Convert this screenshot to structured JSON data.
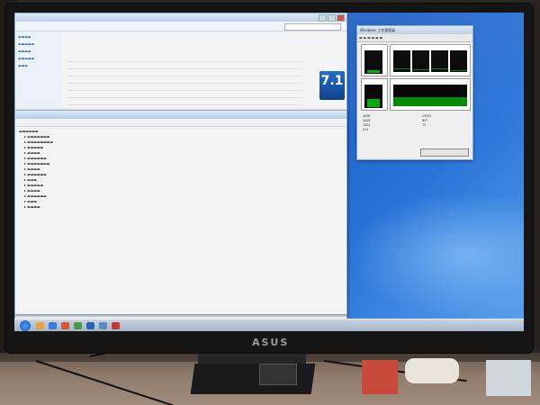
{
  "monitor": {
    "brand_logo": "ASUS"
  },
  "screen_text": {
    "rating_badge": "7.1",
    "task_manager_title": "Windows 工作管理員",
    "mem_stats": {
      "phys_total": "4096",
      "cache": "2048",
      "available": "1024",
      "free": "512",
      "handles": "23342",
      "threads": "857",
      "processes": "72"
    }
  },
  "colors": {
    "desktop_blue": "#2a74d8",
    "window_bg": "#f3f3f3",
    "bezel": "#151515",
    "cpu_graph": "#00aa00"
  },
  "icons": [
    "start-orb-icon",
    "folder-icon",
    "browser-icon",
    "media-icon",
    "windows-logo-icon"
  ]
}
